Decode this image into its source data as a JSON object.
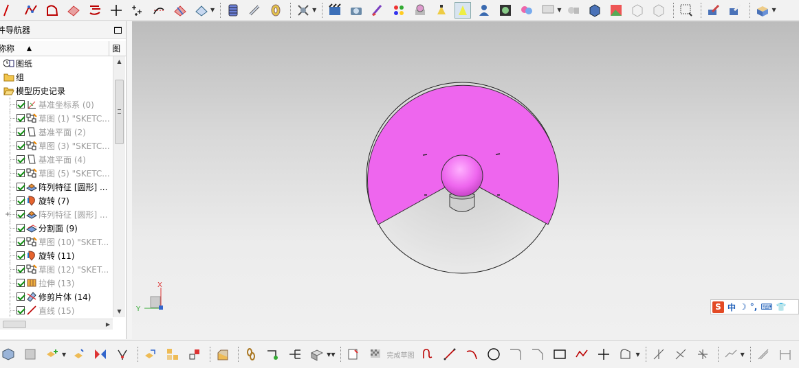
{
  "navigator": {
    "title": "件导航器",
    "col_name": "称称",
    "col_pic": "图"
  },
  "tree": [
    {
      "label": "图纸",
      "icon": "drawing-icon",
      "checkbox": false,
      "dim": false,
      "indent": 0
    },
    {
      "label": "组",
      "icon": "folder-icon",
      "checkbox": false,
      "dim": false,
      "indent": 0
    },
    {
      "label": "模型历史记录",
      "icon": "folder-open-icon",
      "checkbox": false,
      "dim": false,
      "indent": 0
    },
    {
      "label": "基准坐标系 (0)",
      "icon": "datum-csys-icon",
      "checkbox": true,
      "dim": true,
      "indent": 1
    },
    {
      "label": "草图 (1) \"SKETC...",
      "icon": "sketch-icon",
      "checkbox": true,
      "dim": true,
      "indent": 1
    },
    {
      "label": "基准平面 (2)",
      "icon": "datum-plane-icon",
      "checkbox": true,
      "dim": true,
      "indent": 1
    },
    {
      "label": "草图 (3) \"SKETC...",
      "icon": "sketch-icon",
      "checkbox": true,
      "dim": true,
      "indent": 1
    },
    {
      "label": "基准平面 (4)",
      "icon": "datum-plane-icon",
      "checkbox": true,
      "dim": true,
      "indent": 1
    },
    {
      "label": "草图 (5) \"SKETC...",
      "icon": "sketch-icon",
      "checkbox": true,
      "dim": true,
      "indent": 1
    },
    {
      "label": "阵列特征 [圆形] ...",
      "icon": "pattern-feature-icon",
      "checkbox": true,
      "dim": false,
      "indent": 1
    },
    {
      "label": "旋转 (7)",
      "icon": "revolve-icon",
      "checkbox": true,
      "dim": false,
      "indent": 1
    },
    {
      "label": "阵列特征 [圆形] ...",
      "icon": "pattern-feature-icon",
      "checkbox": true,
      "dim": true,
      "indent": 1,
      "expand": true
    },
    {
      "label": "分割面 (9)",
      "icon": "divide-face-icon",
      "checkbox": true,
      "dim": false,
      "indent": 1
    },
    {
      "label": "草图 (10) \"SKET...",
      "icon": "sketch-icon",
      "checkbox": true,
      "dim": true,
      "indent": 1
    },
    {
      "label": "旋转 (11)",
      "icon": "revolve-icon",
      "checkbox": true,
      "dim": false,
      "indent": 1
    },
    {
      "label": "草图 (12) \"SKET...",
      "icon": "sketch-icon",
      "checkbox": true,
      "dim": true,
      "indent": 1
    },
    {
      "label": "拉伸 (13)",
      "icon": "extrude-icon",
      "checkbox": true,
      "dim": true,
      "indent": 1
    },
    {
      "label": "修剪片体 (14)",
      "icon": "trim-sheet-icon",
      "checkbox": true,
      "dim": false,
      "indent": 1
    },
    {
      "label": "直线 (15)",
      "icon": "line-icon",
      "checkbox": true,
      "dim": true,
      "indent": 1
    }
  ],
  "triad": {
    "x": "X",
    "y": "Y"
  },
  "ime": {
    "logo": "S",
    "lang": "中",
    "moon": "☽",
    "punct": "°,",
    "kb": "⌨",
    "shirt": "👕"
  },
  "sketch": {
    "finish_label": "完成草图"
  },
  "colors": {
    "surface": "#ee66ee",
    "viewport_top": "#bcbcbc",
    "viewport_bottom": "#f0f0f0",
    "check": "#0a8a0a"
  }
}
